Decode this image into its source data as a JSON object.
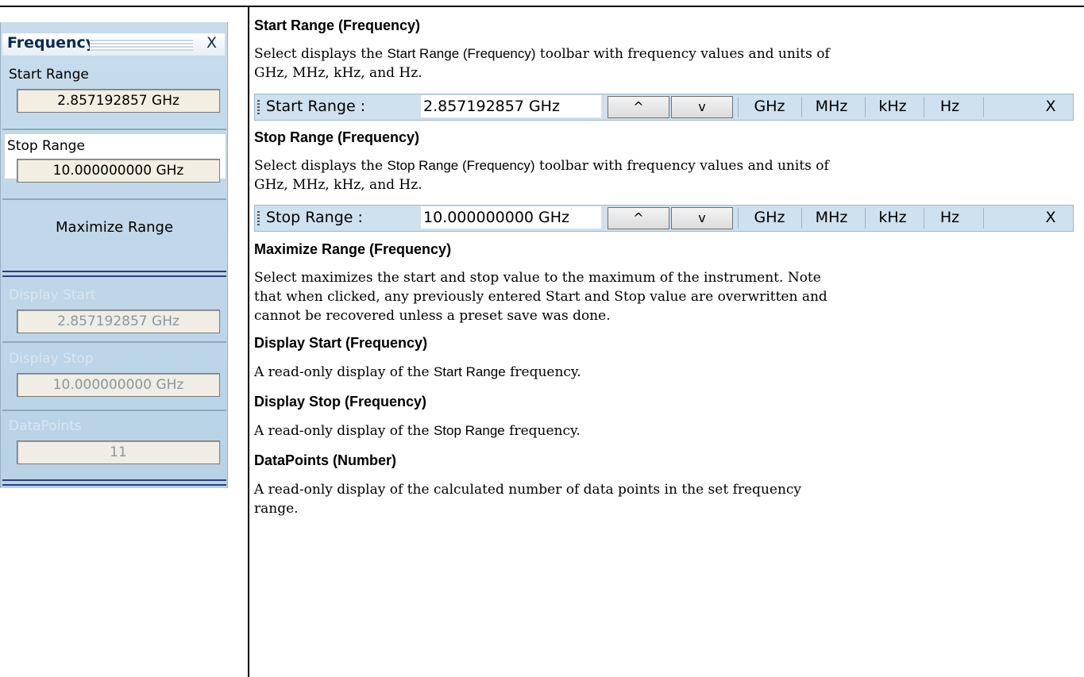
{
  "panel": {
    "title": "Frequency",
    "close": "X",
    "start_range_label": "Start Range",
    "start_range_value": "2.857192857 GHz",
    "stop_range_label": "Stop Range",
    "stop_range_value": "10.000000000 GHz",
    "maximize_label": "Maximize Range",
    "display_start_label": "Display Start",
    "display_start_value": "2.857192857 GHz",
    "display_stop_label": "Display Stop",
    "display_stop_value": "10.000000000 GHz",
    "datapoints_label": "DataPoints",
    "datapoints_value": "11"
  },
  "doc": {
    "h_start": "Start Range (Frequency)",
    "p_start_a": "Select displays the ",
    "p_start_b": "Start Range (Frequency)",
    "p_start_c": " toolbar with frequency values and units of",
    "p_start_d": "GHz, MHz, kHz, and Hz.",
    "h_stop": "Stop Range (Frequency)",
    "p_stop_a": "Select displays the ",
    "p_stop_b": "Stop Range (Frequency)",
    "p_stop_c": " toolbar with frequency values and units of",
    "p_stop_d": "GHz, MHz, kHz, and Hz.",
    "h_max": "Maximize Range (Frequency)",
    "p_max_1": "Select maximizes the start and stop value to the maximum of the instrument. Note",
    "p_max_2": "that when clicked, any previously entered Start and Stop value are overwritten and",
    "p_max_3": "cannot be recovered unless a preset save was done.",
    "h_dstart": "Display Start (Frequency)",
    "p_dstart_a": "A read-only display of the ",
    "p_dstart_b": "Start Range",
    "p_dstart_c": " frequency.",
    "h_dstop": "Display Stop (Frequency)",
    "p_dstop_a": "A read-only display of the ",
    "p_dstop_b": "Stop Range",
    "p_dstop_c": " frequency.",
    "h_dp": "DataPoints (Number)",
    "p_dp_1": "A read-only display of the calculated number of data points in the set frequency",
    "p_dp_2": "range."
  },
  "toolbar_start": {
    "label": "Start Range  :",
    "value": "2.857192857 GHz",
    "up": "^",
    "down": "v",
    "units": [
      "GHz",
      "MHz",
      "kHz",
      "Hz"
    ],
    "close": "X"
  },
  "toolbar_stop": {
    "label": "Stop Range  :",
    "value": "10.000000000 GHz",
    "up": "^",
    "down": "v",
    "units": [
      "GHz",
      "MHz",
      "kHz",
      "Hz"
    ],
    "close": "X"
  }
}
